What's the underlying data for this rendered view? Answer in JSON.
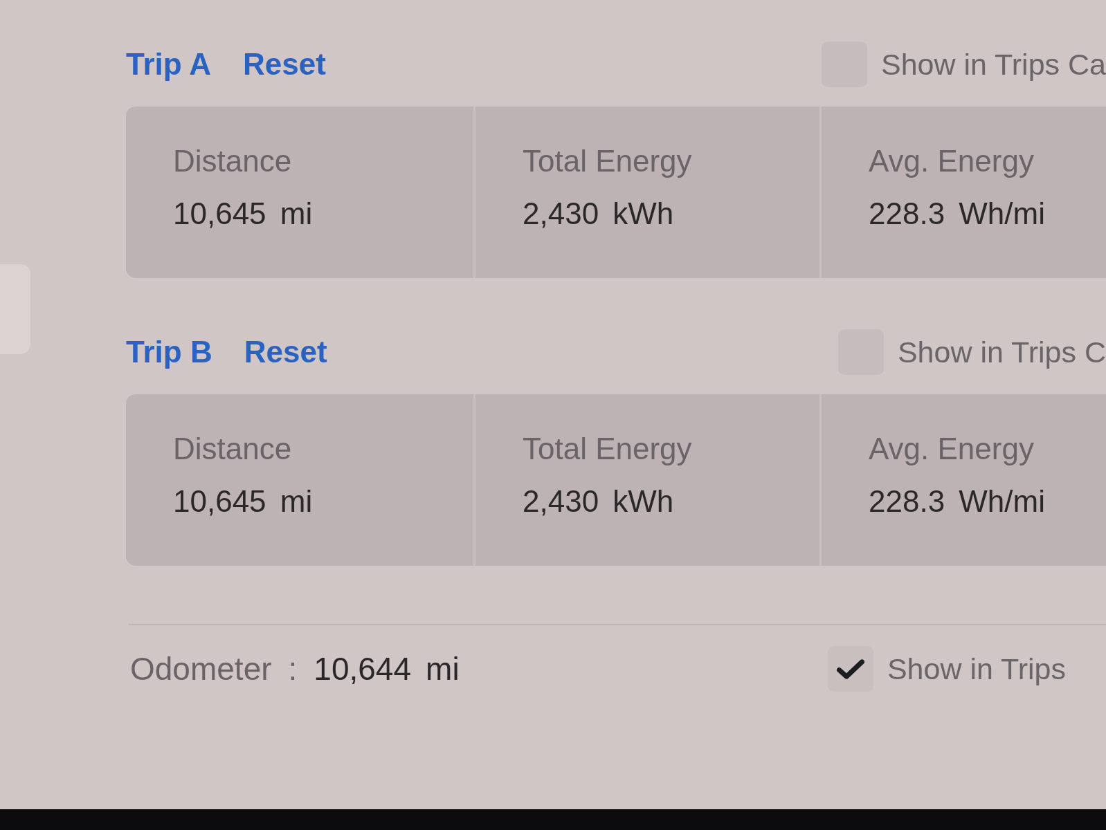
{
  "trips": [
    {
      "title": "Trip A",
      "reset": "Reset",
      "show_in_trips": {
        "label": "Show in Trips Ca",
        "checked": false
      },
      "stats": [
        {
          "label": "Distance",
          "value": "10,645 mi"
        },
        {
          "label": "Total Energy",
          "value": "2,430 kWh"
        },
        {
          "label": "Avg. Energy",
          "value": "228.3 Wh/mi"
        }
      ]
    },
    {
      "title": "Trip B",
      "reset": "Reset",
      "show_in_trips": {
        "label": "Show in Trips C",
        "checked": false
      },
      "stats": [
        {
          "label": "Distance",
          "value": "10,645 mi"
        },
        {
          "label": "Total Energy",
          "value": "2,430 kWh"
        },
        {
          "label": "Avg. Energy",
          "value": "228.3 Wh/mi"
        }
      ]
    }
  ],
  "odometer": {
    "label": "Odometer",
    "separator": ":",
    "value": "10,644 mi",
    "show_in_trips": {
      "label": "Show in Trips",
      "checked": true
    }
  }
}
